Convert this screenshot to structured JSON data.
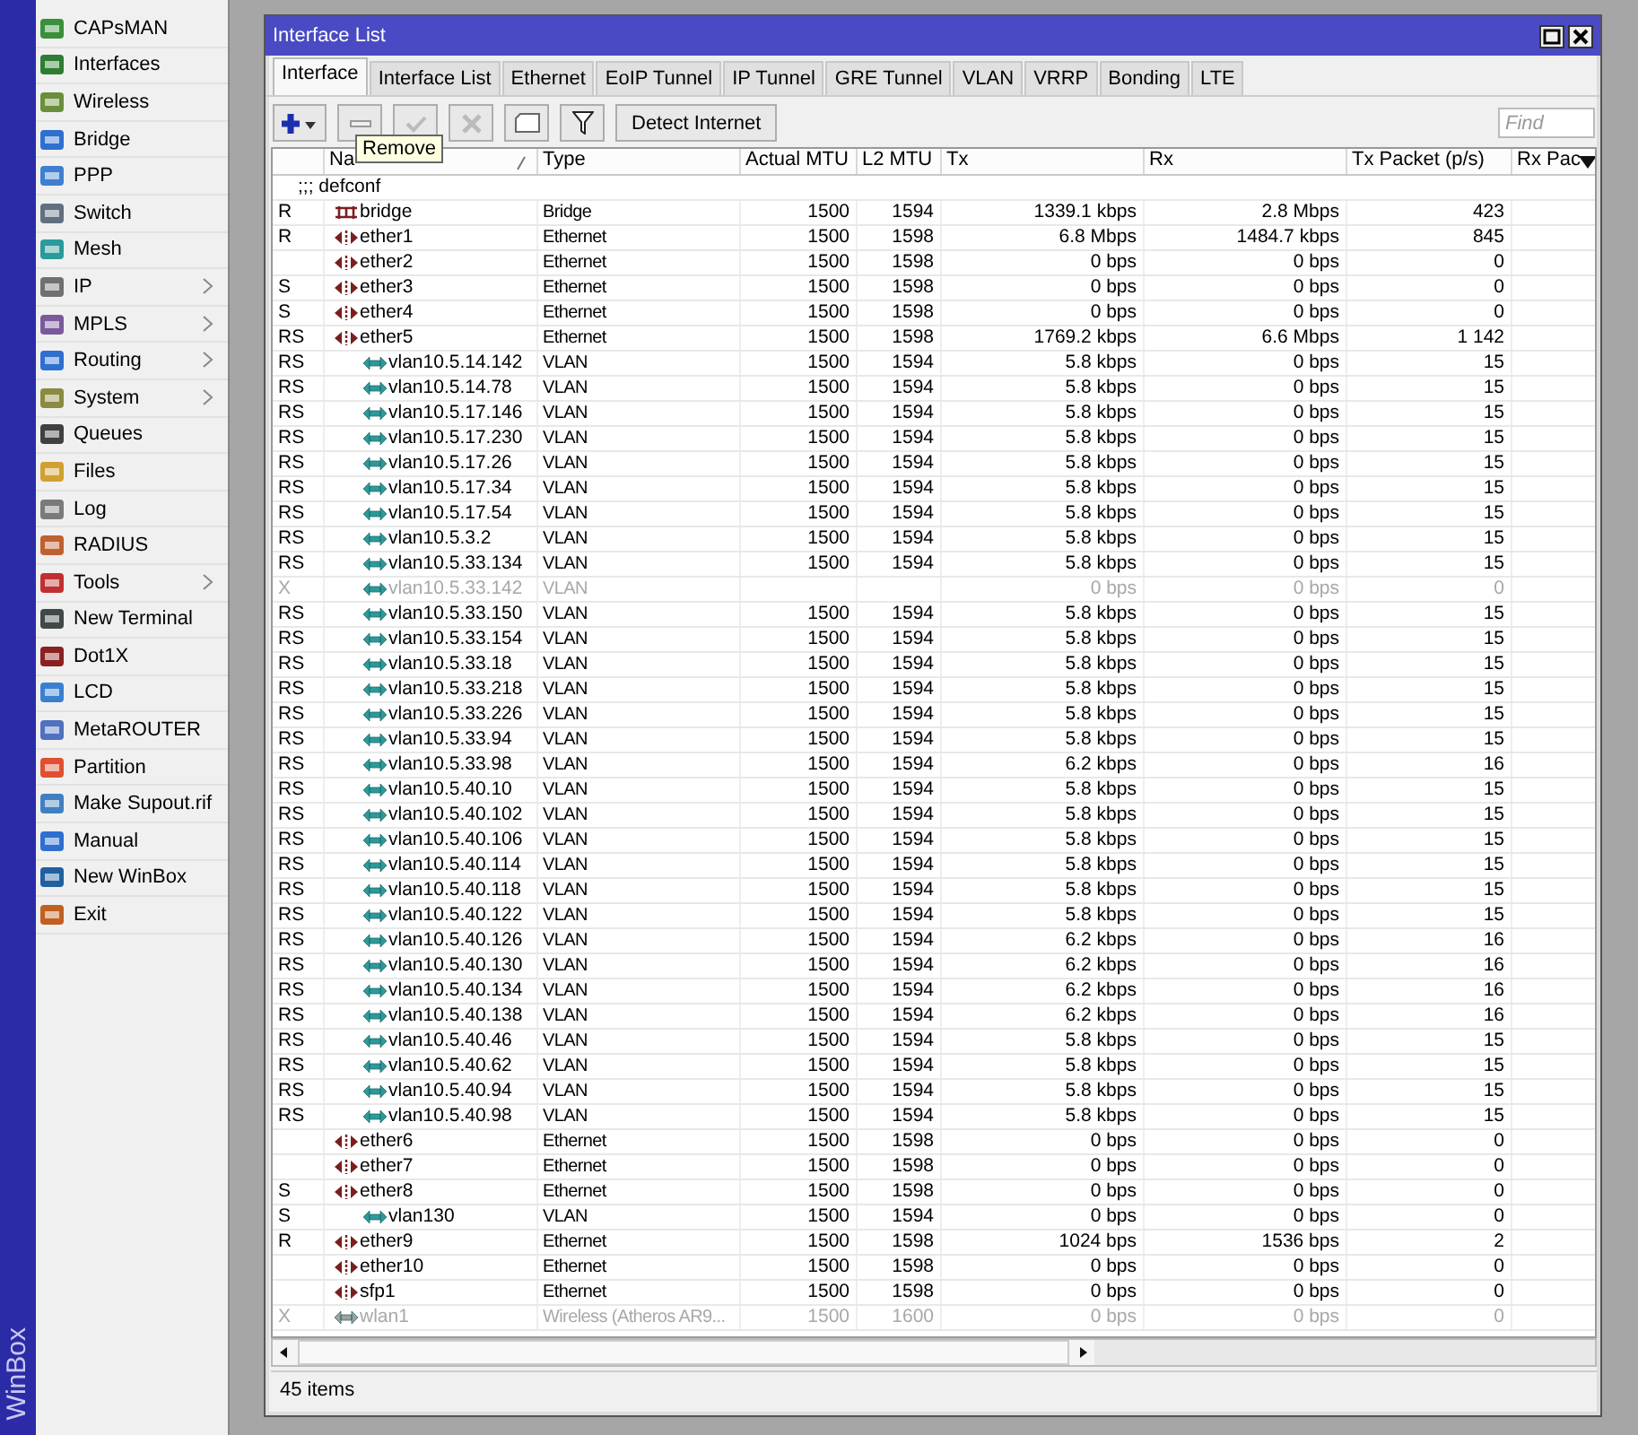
{
  "app_strip": {
    "label": "WinBox"
  },
  "sidebar": {
    "items": [
      {
        "label": "CAPsMAN",
        "submenu": false
      },
      {
        "label": "Interfaces",
        "submenu": false
      },
      {
        "label": "Wireless",
        "submenu": false
      },
      {
        "label": "Bridge",
        "submenu": false
      },
      {
        "label": "PPP",
        "submenu": false
      },
      {
        "label": "Switch",
        "submenu": false
      },
      {
        "label": "Mesh",
        "submenu": false
      },
      {
        "label": "IP",
        "submenu": true
      },
      {
        "label": "MPLS",
        "submenu": true
      },
      {
        "label": "Routing",
        "submenu": true
      },
      {
        "label": "System",
        "submenu": true
      },
      {
        "label": "Queues",
        "submenu": false
      },
      {
        "label": "Files",
        "submenu": false
      },
      {
        "label": "Log",
        "submenu": false
      },
      {
        "label": "RADIUS",
        "submenu": false
      },
      {
        "label": "Tools",
        "submenu": true
      },
      {
        "label": "New Terminal",
        "submenu": false
      },
      {
        "label": "Dot1X",
        "submenu": false
      },
      {
        "label": "LCD",
        "submenu": false
      },
      {
        "label": "MetaROUTER",
        "submenu": false
      },
      {
        "label": "Partition",
        "submenu": false
      },
      {
        "label": "Make Supout.rif",
        "submenu": false
      },
      {
        "label": "Manual",
        "submenu": false
      },
      {
        "label": "New WinBox",
        "submenu": false
      },
      {
        "label": "Exit",
        "submenu": false
      }
    ]
  },
  "window": {
    "title": "Interface List"
  },
  "tabs": [
    {
      "label": "Interface",
      "selected": true
    },
    {
      "label": "Interface List",
      "selected": false
    },
    {
      "label": "Ethernet",
      "selected": false
    },
    {
      "label": "EoIP Tunnel",
      "selected": false
    },
    {
      "label": "IP Tunnel",
      "selected": false
    },
    {
      "label": "GRE Tunnel",
      "selected": false
    },
    {
      "label": "VLAN",
      "selected": false
    },
    {
      "label": "VRRP",
      "selected": false
    },
    {
      "label": "Bonding",
      "selected": false
    },
    {
      "label": "LTE",
      "selected": false
    }
  ],
  "toolbar": {
    "detect_button": "Detect Internet",
    "find": {
      "placeholder": "Find"
    },
    "tooltip": "Remove"
  },
  "table": {
    "columns": [
      "",
      "Na",
      "Type",
      "Actual MTU",
      "L2 MTU",
      "Tx",
      "Rx",
      "Tx Packet (p/s)",
      "Rx Pac"
    ],
    "comment": ";;; defconf",
    "rows": [
      {
        "flags": "R",
        "name": "bridge",
        "kind": "bridge",
        "type": "Bridge",
        "mtu": "1500",
        "l2mtu": "1594",
        "tx": "1339.1 kbps",
        "rx": "2.8 Mbps",
        "tx_packets": "423",
        "disabled": false
      },
      {
        "flags": "R",
        "name": "ether1",
        "kind": "ethernet",
        "type": "Ethernet",
        "mtu": "1500",
        "l2mtu": "1598",
        "tx": "6.8 Mbps",
        "rx": "1484.7 kbps",
        "tx_packets": "845",
        "disabled": false
      },
      {
        "name": "ether2",
        "kind": "ethernet",
        "type": "Ethernet",
        "mtu": "1500",
        "l2mtu": "1598",
        "tx": "0 bps",
        "rx": "0 bps",
        "tx_packets": "0",
        "disabled": false
      },
      {
        "flags": "S",
        "name": "ether3",
        "kind": "ethernet",
        "type": "Ethernet",
        "mtu": "1500",
        "l2mtu": "1598",
        "tx": "0 bps",
        "rx": "0 bps",
        "tx_packets": "0",
        "disabled": false
      },
      {
        "flags": "S",
        "name": "ether4",
        "kind": "ethernet",
        "type": "Ethernet",
        "mtu": "1500",
        "l2mtu": "1598",
        "tx": "0 bps",
        "rx": "0 bps",
        "tx_packets": "0",
        "disabled": false
      },
      {
        "flags": "RS",
        "name": "ether5",
        "kind": "ethernet",
        "type": "Ethernet",
        "mtu": "1500",
        "l2mtu": "1598",
        "tx": "1769.2 kbps",
        "rx": "6.6 Mbps",
        "tx_packets": "1 142",
        "disabled": false,
        "children": [
          {
            "flags": "RS",
            "name": "vlan10.5.14.142",
            "kind": "vlan",
            "type": "VLAN",
            "mtu": "1500",
            "l2mtu": "1594",
            "tx": "5.8 kbps",
            "rx": "0 bps",
            "tx_packets": "15",
            "disabled": false
          },
          {
            "flags": "RS",
            "name": "vlan10.5.14.78",
            "kind": "vlan",
            "type": "VLAN",
            "mtu": "1500",
            "l2mtu": "1594",
            "tx": "5.8 kbps",
            "rx": "0 bps",
            "tx_packets": "15",
            "disabled": false
          },
          {
            "flags": "RS",
            "name": "vlan10.5.17.146",
            "kind": "vlan",
            "type": "VLAN",
            "mtu": "1500",
            "l2mtu": "1594",
            "tx": "5.8 kbps",
            "rx": "0 bps",
            "tx_packets": "15",
            "disabled": false
          },
          {
            "flags": "RS",
            "name": "vlan10.5.17.230",
            "kind": "vlan",
            "type": "VLAN",
            "mtu": "1500",
            "l2mtu": "1594",
            "tx": "5.8 kbps",
            "rx": "0 bps",
            "tx_packets": "15",
            "disabled": false
          },
          {
            "flags": "RS",
            "name": "vlan10.5.17.26",
            "kind": "vlan",
            "type": "VLAN",
            "mtu": "1500",
            "l2mtu": "1594",
            "tx": "5.8 kbps",
            "rx": "0 bps",
            "tx_packets": "15",
            "disabled": false
          },
          {
            "flags": "RS",
            "name": "vlan10.5.17.34",
            "kind": "vlan",
            "type": "VLAN",
            "mtu": "1500",
            "l2mtu": "1594",
            "tx": "5.8 kbps",
            "rx": "0 bps",
            "tx_packets": "15",
            "disabled": false
          },
          {
            "flags": "RS",
            "name": "vlan10.5.17.54",
            "kind": "vlan",
            "type": "VLAN",
            "mtu": "1500",
            "l2mtu": "1594",
            "tx": "5.8 kbps",
            "rx": "0 bps",
            "tx_packets": "15",
            "disabled": false
          },
          {
            "flags": "RS",
            "name": "vlan10.5.3.2",
            "kind": "vlan",
            "type": "VLAN",
            "mtu": "1500",
            "l2mtu": "1594",
            "tx": "5.8 kbps",
            "rx": "0 bps",
            "tx_packets": "15",
            "disabled": false
          },
          {
            "flags": "RS",
            "name": "vlan10.5.33.134",
            "kind": "vlan",
            "type": "VLAN",
            "mtu": "1500",
            "l2mtu": "1594",
            "tx": "5.8 kbps",
            "rx": "0 bps",
            "tx_packets": "15",
            "disabled": false
          },
          {
            "flags": "X",
            "name": "vlan10.5.33.142",
            "kind": "vlan",
            "type": "VLAN",
            "tx": "0 bps",
            "rx": "0 bps",
            "tx_packets": "0",
            "disabled": true
          },
          {
            "flags": "RS",
            "name": "vlan10.5.33.150",
            "kind": "vlan",
            "type": "VLAN",
            "mtu": "1500",
            "l2mtu": "1594",
            "tx": "5.8 kbps",
            "rx": "0 bps",
            "tx_packets": "15",
            "disabled": false
          },
          {
            "flags": "RS",
            "name": "vlan10.5.33.154",
            "kind": "vlan",
            "type": "VLAN",
            "mtu": "1500",
            "l2mtu": "1594",
            "tx": "5.8 kbps",
            "rx": "0 bps",
            "tx_packets": "15",
            "disabled": false
          },
          {
            "flags": "RS",
            "name": "vlan10.5.33.18",
            "kind": "vlan",
            "type": "VLAN",
            "mtu": "1500",
            "l2mtu": "1594",
            "tx": "5.8 kbps",
            "rx": "0 bps",
            "tx_packets": "15",
            "disabled": false
          },
          {
            "flags": "RS",
            "name": "vlan10.5.33.218",
            "kind": "vlan",
            "type": "VLAN",
            "mtu": "1500",
            "l2mtu": "1594",
            "tx": "5.8 kbps",
            "rx": "0 bps",
            "tx_packets": "15",
            "disabled": false
          },
          {
            "flags": "RS",
            "name": "vlan10.5.33.226",
            "kind": "vlan",
            "type": "VLAN",
            "mtu": "1500",
            "l2mtu": "1594",
            "tx": "5.8 kbps",
            "rx": "0 bps",
            "tx_packets": "15",
            "disabled": false
          },
          {
            "flags": "RS",
            "name": "vlan10.5.33.94",
            "kind": "vlan",
            "type": "VLAN",
            "mtu": "1500",
            "l2mtu": "1594",
            "tx": "5.8 kbps",
            "rx": "0 bps",
            "tx_packets": "15",
            "disabled": false
          },
          {
            "flags": "RS",
            "name": "vlan10.5.33.98",
            "kind": "vlan",
            "type": "VLAN",
            "mtu": "1500",
            "l2mtu": "1594",
            "tx": "6.2 kbps",
            "rx": "0 bps",
            "tx_packets": "16",
            "disabled": false
          },
          {
            "flags": "RS",
            "name": "vlan10.5.40.10",
            "kind": "vlan",
            "type": "VLAN",
            "mtu": "1500",
            "l2mtu": "1594",
            "tx": "5.8 kbps",
            "rx": "0 bps",
            "tx_packets": "15",
            "disabled": false
          },
          {
            "flags": "RS",
            "name": "vlan10.5.40.102",
            "kind": "vlan",
            "type": "VLAN",
            "mtu": "1500",
            "l2mtu": "1594",
            "tx": "5.8 kbps",
            "rx": "0 bps",
            "tx_packets": "15",
            "disabled": false
          },
          {
            "flags": "RS",
            "name": "vlan10.5.40.106",
            "kind": "vlan",
            "type": "VLAN",
            "mtu": "1500",
            "l2mtu": "1594",
            "tx": "5.8 kbps",
            "rx": "0 bps",
            "tx_packets": "15",
            "disabled": false
          },
          {
            "flags": "RS",
            "name": "vlan10.5.40.114",
            "kind": "vlan",
            "type": "VLAN",
            "mtu": "1500",
            "l2mtu": "1594",
            "tx": "5.8 kbps",
            "rx": "0 bps",
            "tx_packets": "15",
            "disabled": false
          },
          {
            "flags": "RS",
            "name": "vlan10.5.40.118",
            "kind": "vlan",
            "type": "VLAN",
            "mtu": "1500",
            "l2mtu": "1594",
            "tx": "5.8 kbps",
            "rx": "0 bps",
            "tx_packets": "15",
            "disabled": false
          },
          {
            "flags": "RS",
            "name": "vlan10.5.40.122",
            "kind": "vlan",
            "type": "VLAN",
            "mtu": "1500",
            "l2mtu": "1594",
            "tx": "5.8 kbps",
            "rx": "0 bps",
            "tx_packets": "15",
            "disabled": false
          },
          {
            "flags": "RS",
            "name": "vlan10.5.40.126",
            "kind": "vlan",
            "type": "VLAN",
            "mtu": "1500",
            "l2mtu": "1594",
            "tx": "6.2 kbps",
            "rx": "0 bps",
            "tx_packets": "16",
            "disabled": false
          },
          {
            "flags": "RS",
            "name": "vlan10.5.40.130",
            "kind": "vlan",
            "type": "VLAN",
            "mtu": "1500",
            "l2mtu": "1594",
            "tx": "6.2 kbps",
            "rx": "0 bps",
            "tx_packets": "16",
            "disabled": false
          },
          {
            "flags": "RS",
            "name": "vlan10.5.40.134",
            "kind": "vlan",
            "type": "VLAN",
            "mtu": "1500",
            "l2mtu": "1594",
            "tx": "6.2 kbps",
            "rx": "0 bps",
            "tx_packets": "16",
            "disabled": false
          },
          {
            "flags": "RS",
            "name": "vlan10.5.40.138",
            "kind": "vlan",
            "type": "VLAN",
            "mtu": "1500",
            "l2mtu": "1594",
            "tx": "6.2 kbps",
            "rx": "0 bps",
            "tx_packets": "16",
            "disabled": false
          },
          {
            "flags": "RS",
            "name": "vlan10.5.40.46",
            "kind": "vlan",
            "type": "VLAN",
            "mtu": "1500",
            "l2mtu": "1594",
            "tx": "5.8 kbps",
            "rx": "0 bps",
            "tx_packets": "15",
            "disabled": false
          },
          {
            "flags": "RS",
            "name": "vlan10.5.40.62",
            "kind": "vlan",
            "type": "VLAN",
            "mtu": "1500",
            "l2mtu": "1594",
            "tx": "5.8 kbps",
            "rx": "0 bps",
            "tx_packets": "15",
            "disabled": false
          },
          {
            "flags": "RS",
            "name": "vlan10.5.40.94",
            "kind": "vlan",
            "type": "VLAN",
            "mtu": "1500",
            "l2mtu": "1594",
            "tx": "5.8 kbps",
            "rx": "0 bps",
            "tx_packets": "15",
            "disabled": false
          },
          {
            "flags": "RS",
            "name": "vlan10.5.40.98",
            "kind": "vlan",
            "type": "VLAN",
            "mtu": "1500",
            "l2mtu": "1594",
            "tx": "5.8 kbps",
            "rx": "0 bps",
            "tx_packets": "15",
            "disabled": false
          }
        ]
      },
      {
        "name": "ether6",
        "kind": "ethernet",
        "type": "Ethernet",
        "mtu": "1500",
        "l2mtu": "1598",
        "tx": "0 bps",
        "rx": "0 bps",
        "tx_packets": "0",
        "disabled": false
      },
      {
        "name": "ether7",
        "kind": "ethernet",
        "type": "Ethernet",
        "mtu": "1500",
        "l2mtu": "1598",
        "tx": "0 bps",
        "rx": "0 bps",
        "tx_packets": "0",
        "disabled": false
      },
      {
        "flags": "S",
        "name": "ether8",
        "kind": "ethernet",
        "type": "Ethernet",
        "mtu": "1500",
        "l2mtu": "1598",
        "tx": "0 bps",
        "rx": "0 bps",
        "tx_packets": "0",
        "disabled": false,
        "children": [
          {
            "flags": "S",
            "name": "vlan130",
            "kind": "vlan",
            "type": "VLAN",
            "mtu": "1500",
            "l2mtu": "1594",
            "tx": "0 bps",
            "rx": "0 bps",
            "tx_packets": "0",
            "disabled": false
          }
        ]
      },
      {
        "flags": "R",
        "name": "ether9",
        "kind": "ethernet",
        "type": "Ethernet",
        "mtu": "1500",
        "l2mtu": "1598",
        "tx": "1024 bps",
        "rx": "1536 bps",
        "tx_packets": "2",
        "disabled": false
      },
      {
        "name": "ether10",
        "kind": "ethernet",
        "type": "Ethernet",
        "mtu": "1500",
        "l2mtu": "1598",
        "tx": "0 bps",
        "rx": "0 bps",
        "tx_packets": "0",
        "disabled": false
      },
      {
        "name": "sfp1",
        "kind": "ethernet",
        "type": "Ethernet",
        "mtu": "1500",
        "l2mtu": "1598",
        "tx": "0 bps",
        "rx": "0 bps",
        "tx_packets": "0",
        "disabled": false
      },
      {
        "flags": "X",
        "name": "wlan1",
        "kind": "wireless",
        "type": "Wireless (Atheros AR9...",
        "mtu": "1500",
        "l2mtu": "1600",
        "tx": "0 bps",
        "rx": "0 bps",
        "tx_packets": "0",
        "disabled": true
      }
    ]
  },
  "status_bar": {
    "count": "45 items"
  }
}
